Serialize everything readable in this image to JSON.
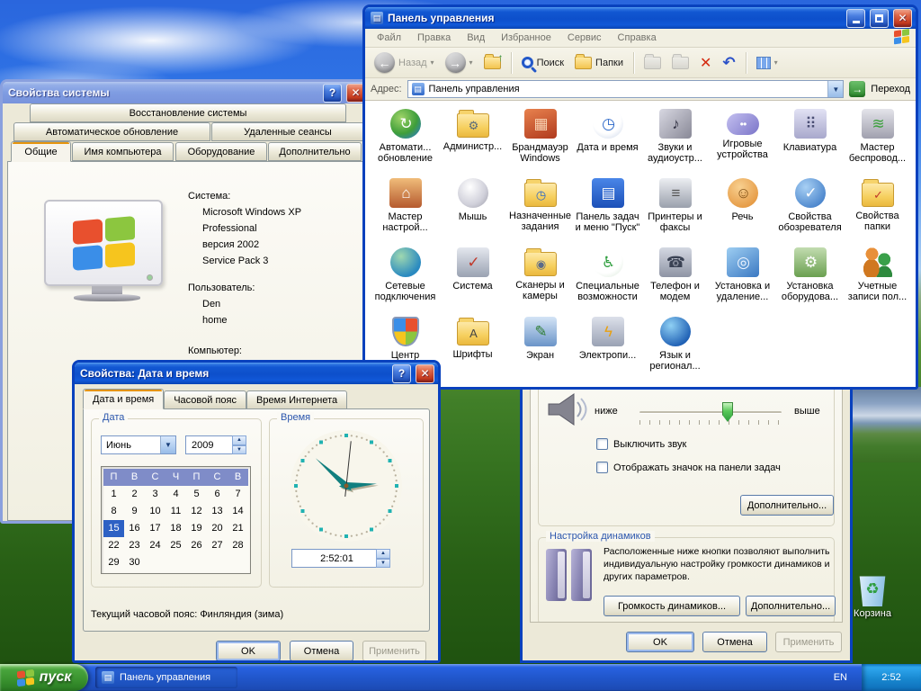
{
  "desktop": {
    "recycle_bin_label": "Корзина"
  },
  "taskbar": {
    "start_label": "пуск",
    "task_label": "Панель управления",
    "lang": "EN",
    "time": "2:52"
  },
  "flag_colors": {
    "red": "#e8502e",
    "green": "#8cc63f",
    "blue": "#3a8ee8",
    "yellow": "#f6c51e"
  },
  "control_panel": {
    "title": "Панель управления",
    "menu": [
      "Файл",
      "Правка",
      "Вид",
      "Избранное",
      "Сервис",
      "Справка"
    ],
    "toolbar": {
      "back": "Назад",
      "search": "Поиск",
      "folders": "Папки"
    },
    "address_label": "Адрес:",
    "address_value": "Панель управления",
    "go_label": "Переход",
    "icons": [
      {
        "id": "automatic-updates",
        "label": [
          "Автомати...",
          "обновление"
        ],
        "glyph": "↻",
        "bg": "radial-gradient(circle at 35% 30%, #9fd468, #3f9e3a 55%, #2c7ec2 90%)",
        "fg": "#ffffff",
        "shape": "round"
      },
      {
        "id": "administrative-tools",
        "label": [
          "Администр..."
        ],
        "glyph": "⚙",
        "bg": "",
        "fg": "#5a6a7a",
        "shape": "folder"
      },
      {
        "id": "windows-firewall",
        "label": [
          "Брандмауэр",
          "Windows"
        ],
        "glyph": "▦",
        "bg": "linear-gradient(160deg,#e8824e,#b03a1e)",
        "fg": "rgba(255,230,200,0.85)",
        "shape": ""
      },
      {
        "id": "date-time",
        "label": [
          "Дата и время"
        ],
        "glyph": "◷",
        "bg": "radial-gradient(circle at 45% 35%, #ffffff 55%, #c8d4e8)",
        "fg": "#2a66c8",
        "shape": "round"
      },
      {
        "id": "sounds-audio",
        "label": [
          "Звуки и",
          "аудиоустр..."
        ],
        "glyph": "♪",
        "bg": "linear-gradient(135deg,#d8d8e2,#888896)",
        "fg": "#333344",
        "shape": ""
      },
      {
        "id": "game-controllers",
        "label": [
          "Игровые",
          "устройства"
        ],
        "glyph": "• •",
        "bg": "linear-gradient(135deg,#c4c0f0,#7a74c8)",
        "fg": "#ffffff",
        "shape": "pill"
      },
      {
        "id": "keyboard",
        "label": [
          "Клавиатура"
        ],
        "glyph": "⠿",
        "bg": "linear-gradient(#e2e2f4,#a8a8cc)",
        "fg": "#4a4e74",
        "shape": ""
      },
      {
        "id": "wireless-wizard",
        "label": [
          "Мастер",
          "беспровод..."
        ],
        "glyph": "≋",
        "bg": "linear-gradient(#e4e4ea,#a0a0ae)",
        "fg": "#3aa03a",
        "shape": ""
      },
      {
        "id": "network-setup-wizard",
        "label": [
          "Мастер",
          "настрой..."
        ],
        "glyph": "⌂",
        "bg": "linear-gradient(#f0bc7a,#b55a2e)",
        "fg": "#ffffff",
        "shape": ""
      },
      {
        "id": "mouse",
        "label": [
          "Мышь"
        ],
        "glyph": "",
        "bg": "radial-gradient(ellipse at 40% 30%, #ffffff, #d0d0da 60%, #9a9aa6)",
        "fg": "#666666",
        "shape": "round"
      },
      {
        "id": "scheduled-tasks",
        "label": [
          "Назначенные",
          "задания"
        ],
        "glyph": "◷",
        "bg": "",
        "fg": "#2a66c8",
        "shape": "folder"
      },
      {
        "id": "taskbar-start-menu",
        "label": [
          "Панель задач",
          "и меню \"Пуск\""
        ],
        "glyph": "▤",
        "bg": "linear-gradient(#4a86e8,#1c50b8)",
        "fg": "#ffffff",
        "shape": ""
      },
      {
        "id": "printers-faxes",
        "label": [
          "Принтеры и",
          "факсы"
        ],
        "glyph": "≡",
        "bg": "linear-gradient(#eceef2,#9aa0ac)",
        "fg": "#555555",
        "shape": ""
      },
      {
        "id": "speech",
        "label": [
          "Речь"
        ],
        "glyph": "☺",
        "bg": "radial-gradient(circle at 40% 30%, #f8d090, #e08a2e)",
        "fg": "#7a4a10",
        "shape": "round"
      },
      {
        "id": "internet-options",
        "label": [
          "Свойства",
          "обозревателя"
        ],
        "glyph": "✓",
        "bg": "radial-gradient(circle at 35% 30%, #a8d0f4, #2f6fc0)",
        "fg": "#ffffff",
        "shape": "round"
      },
      {
        "id": "folder-options",
        "label": [
          "Свойства",
          "папки"
        ],
        "glyph": "✓",
        "bg": "",
        "fg": "#c0392b",
        "shape": "folder"
      },
      {
        "id": "network-connections",
        "label": [
          "Сетевые",
          "подключения"
        ],
        "glyph": "",
        "bg": "radial-gradient(circle at 35% 30%, #9fd8b0, #2a8ac0 70%)",
        "fg": "#ffffff",
        "shape": "round"
      },
      {
        "id": "system",
        "label": [
          "Система"
        ],
        "glyph": "✓",
        "bg": "linear-gradient(#e4e7ee,#9aa2b2)",
        "fg": "#c0392b",
        "shape": ""
      },
      {
        "id": "scanners-cameras",
        "label": [
          "Сканеры и",
          "камеры"
        ],
        "glyph": "◉",
        "bg": "",
        "fg": "#5a6a8a",
        "shape": "folder"
      },
      {
        "id": "accessibility",
        "label": [
          "Специальные",
          "возможности"
        ],
        "glyph": "♿",
        "bg": "radial-gradient(circle at 40% 30%, #ffffff 60%, #d8e8d8)",
        "fg": "#2e9e3e",
        "shape": "round"
      },
      {
        "id": "phone-modem",
        "label": [
          "Телефон и",
          "модем"
        ],
        "glyph": "☎",
        "bg": "linear-gradient(#d4d8e2,#8e94a4)",
        "fg": "#3a4254",
        "shape": ""
      },
      {
        "id": "add-remove-programs",
        "label": [
          "Установка и",
          "удаление..."
        ],
        "glyph": "◎",
        "bg": "linear-gradient(145deg,#9ecef2,#3a78c2)",
        "fg": "#f0f6ff",
        "shape": ""
      },
      {
        "id": "add-hardware",
        "label": [
          "Установка",
          "оборудова..."
        ],
        "glyph": "⚙",
        "bg": "linear-gradient(#c2dcb0,#6aa050)",
        "fg": "#ffffff",
        "shape": ""
      },
      {
        "id": "user-accounts",
        "label": [
          "Учетные",
          "записи пол..."
        ],
        "glyph": "",
        "bg": "",
        "fg": "#ffffff",
        "shape": "people"
      },
      {
        "id": "security-center",
        "label": [
          "Центр"
        ],
        "glyph": "",
        "bg": "conic-gradient(from 0deg, #e8502e 0 25%, #8cc63f 0 50%, #f6c51e 0 75%, #3a8ee8 0)",
        "fg": "#ffffff",
        "shape": "shield"
      },
      {
        "id": "fonts",
        "label": [
          "Шрифты"
        ],
        "glyph": "A",
        "bg": "",
        "fg": "#444444",
        "shape": "folder"
      },
      {
        "id": "display",
        "label": [
          "Экран"
        ],
        "glyph": "✎",
        "bg": "linear-gradient(#d4e4f6,#6a94c8)",
        "fg": "#2e7d32",
        "shape": ""
      },
      {
        "id": "power-options",
        "label": [
          "Электропи..."
        ],
        "glyph": "ϟ",
        "bg": "linear-gradient(#dce0ea,#9aa2b4)",
        "fg": "#e8a010",
        "shape": ""
      },
      {
        "id": "regional-language",
        "label": [
          "Язык и",
          "регионал..."
        ],
        "glyph": "",
        "bg": "radial-gradient(circle at 35% 30%, #8fd0f4, #1e5fb4 75%)",
        "fg": "#ffffff",
        "shape": "round"
      }
    ]
  },
  "system_properties": {
    "title": "Свойства системы",
    "tabs_top": [
      "Восстановление системы"
    ],
    "tabs_mid": [
      "Автоматическое обновление",
      "Удаленные сеансы"
    ],
    "tabs_bottom": [
      "Общие",
      "Имя компьютера",
      "Оборудование",
      "Дополнительно"
    ],
    "system_label": "Система:",
    "system_lines": [
      "Microsoft Windows XP",
      "Professional",
      "версия 2002",
      "Service Pack 3"
    ],
    "user_label": "Пользователь:",
    "user_lines": [
      "Den",
      "home"
    ],
    "computer_label": "Компьютер:"
  },
  "datetime_dialog": {
    "title": "Свойства: Дата и время",
    "tabs": [
      "Дата и время",
      "Часовой пояс",
      "Время Интернета"
    ],
    "date_group_label": "Дата",
    "time_group_label": "Время",
    "month": "Июнь",
    "year": "2009",
    "calendar": {
      "header": [
        "П",
        "В",
        "С",
        "Ч",
        "П",
        "С",
        "В"
      ],
      "weeks": [
        [
          1,
          2,
          3,
          4,
          5,
          6,
          7
        ],
        [
          8,
          9,
          10,
          11,
          12,
          13,
          14
        ],
        [
          15,
          16,
          17,
          18,
          19,
          20,
          21
        ],
        [
          22,
          23,
          24,
          25,
          26,
          27,
          28
        ],
        [
          29,
          30,
          null,
          null,
          null,
          null,
          null
        ]
      ],
      "selected": 15
    },
    "time_value": "2:52:01",
    "timezone_note": "Текущий часовой пояс: Финляндия (зима)",
    "buttons": {
      "ok": "OK",
      "cancel": "Отмена",
      "apply": "Применить"
    }
  },
  "sound_dialog": {
    "slider_low": "ниже",
    "slider_high": "выше",
    "mute_label": "Выключить звук",
    "tray_icon_label": "Отображать значок на панели задач",
    "advanced1": "Дополнительно...",
    "speakers_group_label": "Настройка динамиков",
    "speakers_text": "Расположенные ниже кнопки позволяют выполнить индивидуальную настройку громкости динамиков и других параметров.",
    "speaker_volume_btn": "Громкость динамиков...",
    "advanced2": "Дополнительно...",
    "buttons": {
      "ok": "OK",
      "cancel": "Отмена",
      "apply": "Применить"
    }
  }
}
